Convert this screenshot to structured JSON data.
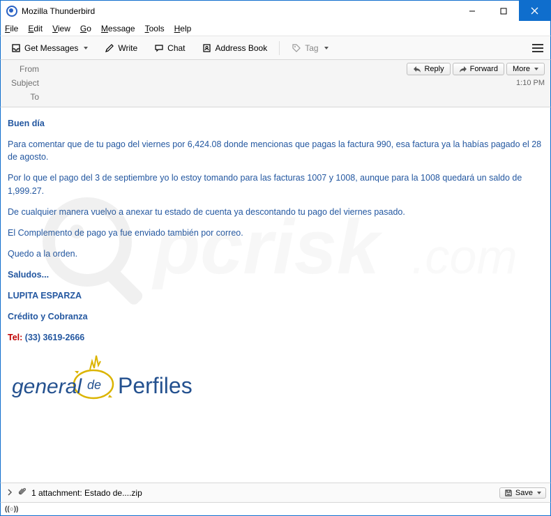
{
  "window": {
    "title": "Mozilla Thunderbird"
  },
  "menubar": [
    "File",
    "Edit",
    "View",
    "Go",
    "Message",
    "Tools",
    "Help"
  ],
  "toolbar": {
    "get_messages": "Get Messages",
    "write": "Write",
    "chat": "Chat",
    "address_book": "Address Book",
    "tag": "Tag"
  },
  "msgheader": {
    "from_label": "From",
    "subject_label": "Subject",
    "to_label": "To",
    "reply": "Reply",
    "forward": "Forward",
    "more": "More",
    "time": "1:10 PM"
  },
  "body": {
    "greeting": "Buen día",
    "p1": "Para comentar que de tu pago del viernes por  6,424.08 donde mencionas que pagas la factura 990, esa factura ya la habías pagado el 28 de agosto.",
    "p2": "Por lo que el pago del 3 de septiembre yo lo estoy tomando para las facturas 1007 y 1008, aunque para la 1008 quedará un saldo de 1,999.27.",
    "p3": "De cualquier manera vuelvo a anexar tu estado de cuenta ya descontando tu pago del viernes pasado.",
    "p4": "El Complemento de pago ya fue enviado también por correo.",
    "p5": "Quedo a la orden.",
    "saludos": "Saludos...",
    "name": "LUPITA ESPARZA",
    "dept": "Crédito y Cobranza",
    "tel_label": "Tel:",
    "tel_value": "(33) 3619-2666",
    "logo_general": "general",
    "logo_de": "de",
    "logo_perfiles": "Perfiles"
  },
  "attachment": {
    "text": "1 attachment: Estado de....zip",
    "save": "Save"
  },
  "status": {
    "icon": "((○))"
  }
}
